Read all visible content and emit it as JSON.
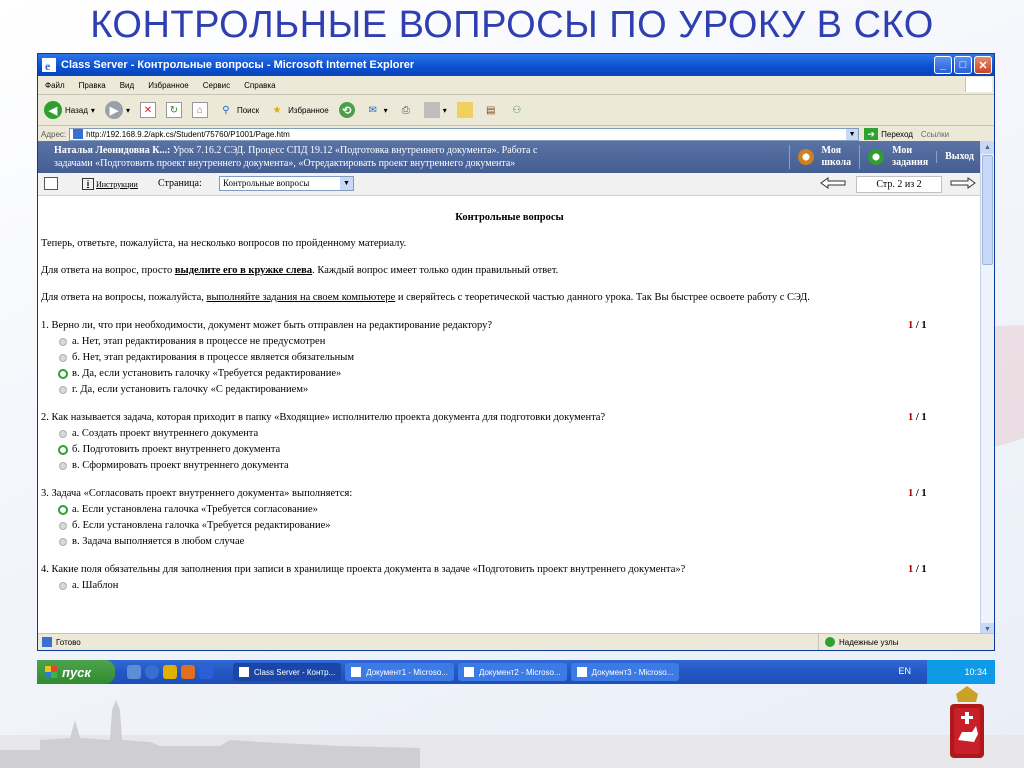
{
  "slide": {
    "title": "КОНТРОЛЬНЫЕ ВОПРОСЫ ПО УРОКУ В СКО"
  },
  "window": {
    "title": "Class Server - Контрольные вопросы - Microsoft Internet Explorer"
  },
  "menu": [
    "Файл",
    "Правка",
    "Вид",
    "Избранное",
    "Сервис",
    "Справка"
  ],
  "toolbar": {
    "back": "Назад",
    "search": "Поиск",
    "favorites": "Избранное"
  },
  "address": {
    "label": "Адрес:",
    "url": "http://192.168.9.2/apk.cs/Student/75760/P1001/Page.htm",
    "go": "Переход",
    "links": "Ссылки"
  },
  "lesson": {
    "user": "Наталья Леонидовна К...:",
    "line1": " Урок 7.16.2 СЭД. Процесс СПД 19.12 «Подготовка внутреннего документа». Работа с",
    "line2": "задачами «Подготовить проект внутреннего документа», «Отредактировать проект внутреннего документа»",
    "nav_school_1": "Моя",
    "nav_school_2": "школа",
    "nav_tasks_1": "Мои",
    "nav_tasks_2": "задания",
    "nav_exit": "Выход"
  },
  "pagebar": {
    "instructions": "Инструкции",
    "page_label": "Страница:",
    "page_select": "Контрольные вопросы",
    "counter": "Стр.  2 из 2"
  },
  "doc": {
    "title": "Контрольные вопросы",
    "intro": "Теперь, ответьте, пожалуйста, на несколько вопросов по пройденному материалу.",
    "p2_a": "Для ответа на вопрос, просто ",
    "p2_b": "выделите его в кружке слева",
    "p2_c": ". Каждый вопрос имеет только один правильный ответ.",
    "p3_a": "Для ответа на вопросы, пожалуйста, ",
    "p3_b": "выполняйте задания на своем компьютере",
    "p3_c": " и сверяйтесь с теоретической частью данного урока. Так Вы быстрее освоете работу с СЭД."
  },
  "questions": [
    {
      "text": "1. Верно ли, что при необходимости, документ может быть отправлен на редактирование редактору?",
      "score_a": "1",
      "score_sep": " / ",
      "score_b": "1",
      "options": [
        {
          "text": "а. Нет, этап редактирования в процессе не предусмотрен",
          "selected": false
        },
        {
          "text": "б. Нет, этап редактирования в процессе является обязательным",
          "selected": false
        },
        {
          "text": "в. Да, если установить галочку «Требуется редактирование»",
          "selected": true
        },
        {
          "text": "г. Да, если установить галочку «С редактированием»",
          "selected": false
        }
      ]
    },
    {
      "text": "2. Как называется задача, которая приходит в папку «Входящие» исполнителю проекта документа для подготовки документа?",
      "score_a": "1",
      "score_sep": " / ",
      "score_b": "1",
      "options": [
        {
          "text": "а. Создать проект внутреннего документа",
          "selected": false
        },
        {
          "text": "б. Подготовить проект внутреннего документа",
          "selected": true
        },
        {
          "text": "в. Сформировать проект внутреннего документа",
          "selected": false
        }
      ]
    },
    {
      "text": "3. Задача «Согласовать проект внутреннего документа» выполняется:",
      "score_a": "1",
      "score_sep": " / ",
      "score_b": "1",
      "options": [
        {
          "text": "а. Если установлена галочка «Требуется согласование»",
          "selected": true
        },
        {
          "text": "б. Если установлена галочка «Требуется редактирование»",
          "selected": false
        },
        {
          "text": "в. Задача выполняется в любом случае",
          "selected": false
        }
      ]
    },
    {
      "text": "4. Какие поля обязательны для заполнения при записи в хранилище проекта документа в задаче «Подготовить проект внутреннего документа»?",
      "score_a": "1",
      "score_sep": " / ",
      "score_b": "1",
      "options": [
        {
          "text": "а. Шаблон",
          "selected": false
        }
      ]
    }
  ],
  "status": {
    "ready": "Готово",
    "zone": "Надежные узлы"
  },
  "taskbar": {
    "start": "пуск",
    "tasks": [
      "Class Server - Контр...",
      "Документ1 - Microso...",
      "Документ2 - Microso...",
      "Документ3 - Microso..."
    ],
    "lang": "EN",
    "clock": "10:34"
  },
  "colors": {
    "title_blue": "#2f3fb0",
    "header_blue": "#4b6499",
    "selected_radio": "#2f9f2f",
    "score_red": "#b00000"
  }
}
